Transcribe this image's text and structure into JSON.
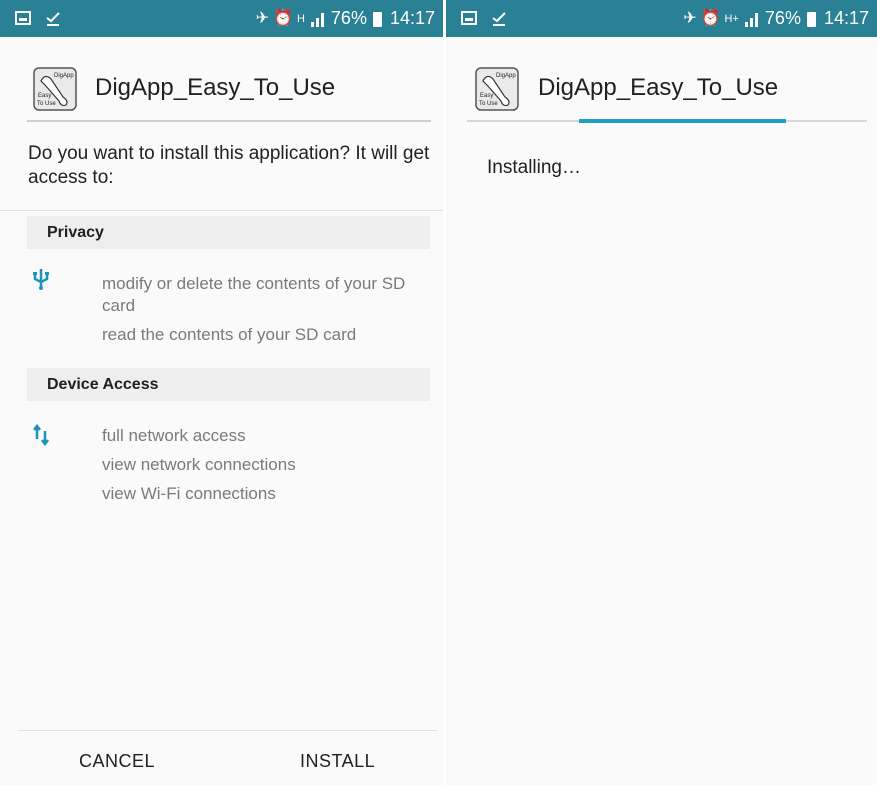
{
  "status_bar": {
    "left_icons": [
      "gallery-icon",
      "download-done-icon"
    ],
    "right_icons": [
      "mute-icon",
      "alarm-icon",
      "network-type-icon",
      "signal-icon",
      "battery-icon"
    ],
    "battery_percent": "76%",
    "time": "14:17",
    "color": "#2a8195"
  },
  "left_screen": {
    "app_icon_text": [
      "DigApp",
      "Easy",
      "To Use"
    ],
    "app_name": "DigApp_Easy_To_Use",
    "question": "Do you want to install this application? It will get access to:",
    "sections": [
      {
        "title": "Privacy",
        "icon": "usb-icon",
        "items": [
          "modify or delete the contents of your SD card",
          "read the contents of your SD card"
        ]
      },
      {
        "title": "Device Access",
        "icon": "network-arrows-icon",
        "items": [
          "full network access",
          "view network connections",
          "view Wi-Fi connections"
        ]
      }
    ],
    "buttons": {
      "cancel": "CANCEL",
      "install": "INSTALL"
    }
  },
  "right_screen": {
    "app_icon_text": [
      "DigApp",
      "Easy",
      "To Use"
    ],
    "app_name": "DigApp_Easy_To_Use",
    "status": "Installing…",
    "progress_color": "#1f9dc3"
  }
}
